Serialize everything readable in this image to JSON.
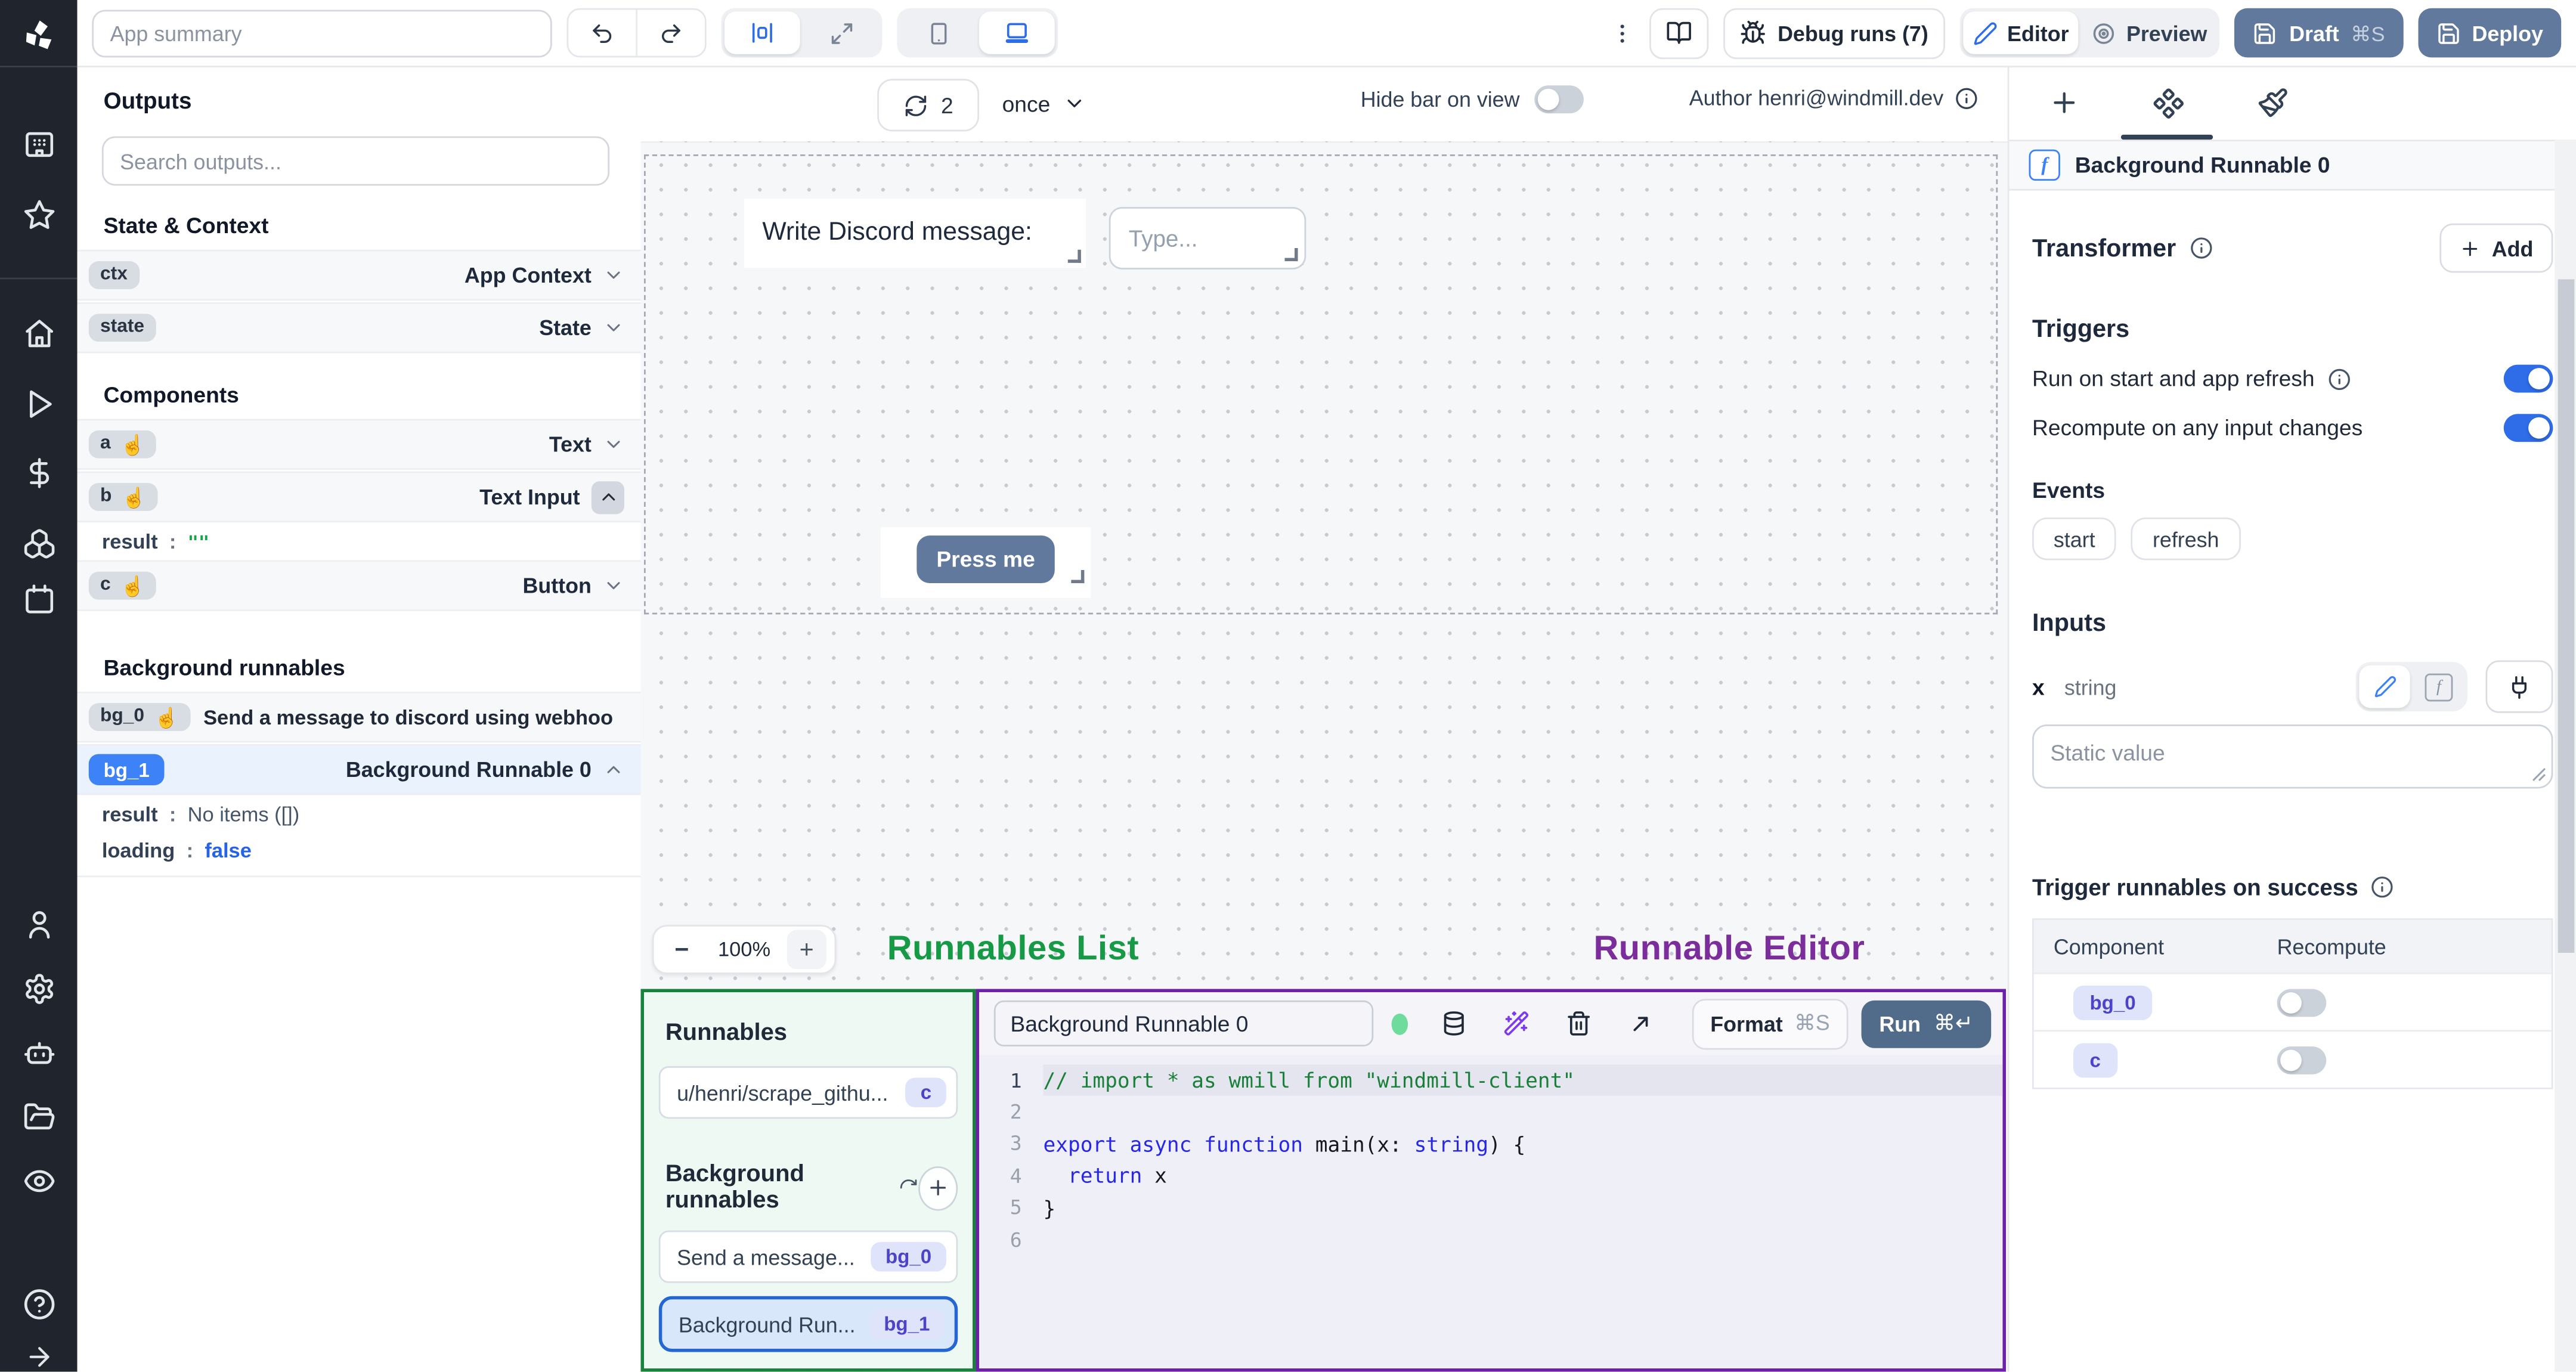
{
  "topbar": {
    "summary_placeholder": "App summary",
    "debug_label": "Debug runs (7)",
    "editor_label": "Editor",
    "preview_label": "Preview",
    "draft_label": "Draft",
    "draft_kbd": "⌘S",
    "deploy_label": "Deploy"
  },
  "outputs": {
    "title": "Outputs",
    "search_placeholder": "Search outputs...",
    "section_state_context": "State & Context",
    "section_components": "Components",
    "section_background": "Background runnables",
    "ctx_badge": "ctx",
    "ctx_type": "App Context",
    "state_badge": "state",
    "state_type": "State",
    "a_badge": "a",
    "a_type": "Text",
    "b_badge": "b",
    "b_type": "Text Input",
    "b_result_key": "result",
    "b_result_value": "\"\"",
    "c_badge": "c",
    "c_type": "Button",
    "bg0_badge": "bg_0",
    "bg0_label": "Send a message to discord using webhoo",
    "bg1_badge": "bg_1",
    "bg1_label": "Background Runnable 0",
    "bg1_result_key": "result",
    "bg1_result_value": "No items ([])",
    "bg1_loading_key": "loading",
    "bg1_loading_value": "false",
    "hand_icon": "☝"
  },
  "canvas": {
    "refresh_count": "2",
    "interval": "once",
    "hide_bar_label": "Hide bar on view",
    "author_label": "Author henri@windmill.dev",
    "text_component": "Write Discord message:",
    "input_placeholder": "Type...",
    "button_label": "Press me",
    "zoom_minus": "−",
    "zoom_level": "100%",
    "zoom_plus": "+"
  },
  "annotations": {
    "runnables_list": "Runnables List",
    "runnable_editor": "Runnable Editor"
  },
  "runnables_panel": {
    "title": "Runnables",
    "script_label": "u/henri/scrape_githu...",
    "script_badge": "c",
    "background_title": "Background runnables",
    "bg0_label": "Send a message...",
    "bg0_badge": "bg_0",
    "bg1_label": "Background Run...",
    "bg1_badge": "bg_1"
  },
  "editor": {
    "name": "Background Runnable 0",
    "format_label": "Format",
    "format_kbd": "⌘S",
    "run_label": "Run",
    "run_kbd": "⌘↵",
    "code": {
      "language": "typescript",
      "lines": [
        {
          "n": "1",
          "highlight": true,
          "tokens": [
            [
              "c",
              "// import * as wmill from \"windmill-client\""
            ]
          ]
        },
        {
          "n": "2",
          "highlight": false,
          "tokens": []
        },
        {
          "n": "3",
          "highlight": false,
          "tokens": [
            [
              "k",
              "export"
            ],
            [
              "d",
              " "
            ],
            [
              "k",
              "async"
            ],
            [
              "d",
              " "
            ],
            [
              "k",
              "function"
            ],
            [
              "d",
              " main("
            ],
            [
              "d",
              "x"
            ],
            [
              "d",
              ": "
            ],
            [
              "k",
              "string"
            ],
            [
              "d",
              ") {"
            ]
          ]
        },
        {
          "n": "4",
          "highlight": false,
          "tokens": [
            [
              "d",
              "  "
            ],
            [
              "k",
              "return"
            ],
            [
              "d",
              " x"
            ]
          ]
        },
        {
          "n": "5",
          "highlight": false,
          "tokens": [
            [
              "d",
              "}"
            ]
          ]
        },
        {
          "n": "6",
          "highlight": false,
          "tokens": []
        }
      ]
    }
  },
  "right_panel": {
    "header": "Background Runnable 0",
    "transformer_label": "Transformer",
    "add_label": "Add",
    "triggers_label": "Triggers",
    "run_on_start_label": "Run on start and app refresh",
    "recompute_label": "Recompute on any input changes",
    "events_label": "Events",
    "event_start": "start",
    "event_refresh": "refresh",
    "inputs_label": "Inputs",
    "input_name": "x",
    "input_type": "string",
    "static_placeholder": "Static value",
    "success_label": "Trigger runnables on success",
    "table": {
      "col_component": "Component",
      "col_recompute": "Recompute",
      "rows": [
        {
          "component": "bg_0",
          "recompute_on": false
        },
        {
          "component": "c",
          "recompute_on": false
        }
      ]
    }
  },
  "colors": {
    "accent_blue": "#2f6ce8",
    "slate_button": "#60799c",
    "annotation_green": "#169a46",
    "annotation_purple": "#7c2d9c",
    "sidebar_dark": "#20252d"
  }
}
